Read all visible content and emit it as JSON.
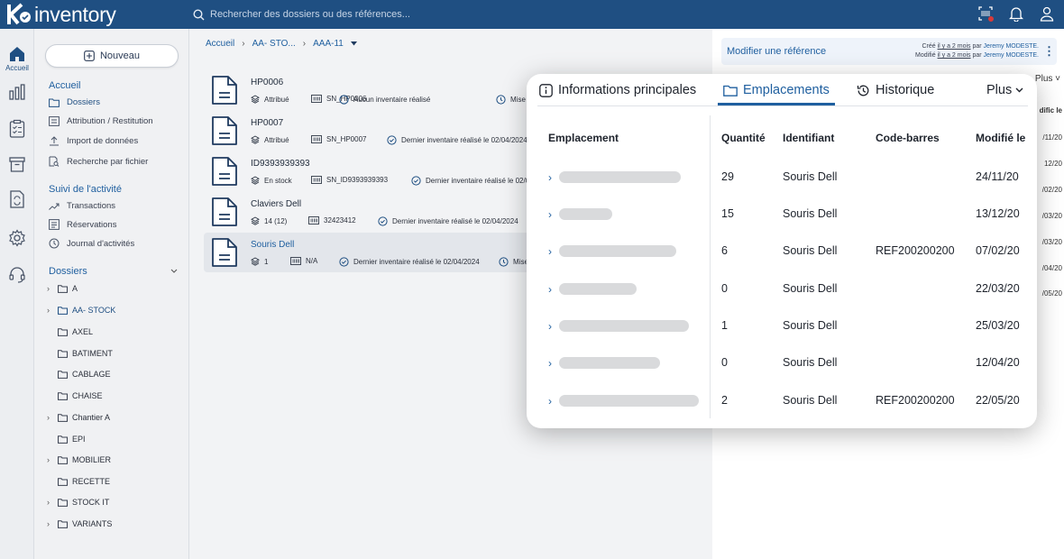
{
  "app": {
    "logo_text": "inventory"
  },
  "search": {
    "placeholder": "Rechercher des dossiers ou des références..."
  },
  "rail": {
    "home_label": "Accueil"
  },
  "sidebar": {
    "new_button": "Nouveau",
    "section_home": "Accueil",
    "home_items": [
      "Dossiers",
      "Attribution / Restitution",
      "Import de données",
      "Recherche par fichier"
    ],
    "section_activity": "Suivi de l'activité",
    "activity_items": [
      "Transactions",
      "Réservations",
      "Journal d'activités"
    ],
    "section_folders": "Dossiers",
    "folders": [
      {
        "name": "A",
        "expandable": true
      },
      {
        "name": "AA- STOCK",
        "expandable": true
      },
      {
        "name": "AXEL",
        "expandable": false
      },
      {
        "name": "BATIMENT",
        "expandable": false
      },
      {
        "name": "CABLAGE",
        "expandable": false
      },
      {
        "name": "CHAISE",
        "expandable": false
      },
      {
        "name": "Chantier A",
        "expandable": true
      },
      {
        "name": "EPI",
        "expandable": false
      },
      {
        "name": "MOBILIER",
        "expandable": true
      },
      {
        "name": "RECETTE",
        "expandable": false
      },
      {
        "name": "STOCK IT",
        "expandable": true
      },
      {
        "name": "VARIANTS",
        "expandable": true
      }
    ]
  },
  "breadcrumb": [
    "Accueil",
    "AA- STO...",
    "AAA-11"
  ],
  "items": [
    {
      "title": "HP0006",
      "status": "Attribué",
      "serial": "SN_HP0006",
      "inventory": "Aucun inventaire réalisé",
      "extra": "Mise"
    },
    {
      "title": "HP0007",
      "status": "Attribué",
      "serial": "SN_HP0007",
      "inventory": "Dernier inventaire réalisé le 02/04/2024",
      "extra": ""
    },
    {
      "title": "ID9393939393",
      "status": "En stock",
      "serial": "SN_ID9393939393",
      "inventory": "Dernier inventaire réalisé le 02/04",
      "extra": ""
    },
    {
      "title": "Claviers Dell",
      "status": "14 (12)",
      "serial": "32423412",
      "inventory": "Dernier inventaire réalisé le 02/04/2024",
      "extra": ""
    },
    {
      "title": "Souris Dell",
      "status": "1",
      "serial": "N/A",
      "inventory": "Dernier inventaire réalisé le 02/04/2024",
      "extra": "Mise"
    }
  ],
  "panel": {
    "title": "Modifier une référence",
    "created_prefix": "Créé ",
    "created_when": "il y a 2 mois",
    "created_by": " par ",
    "created_user": "Jeremy MODESTE.",
    "modified_prefix": "Modifié ",
    "modified_when": "il y a 2 mois",
    "modified_by": " par ",
    "modified_user": "Jeremy MODESTE.",
    "more": "Plus",
    "col_partial": "dific le",
    "dates_partial": [
      "/11/20",
      "12/20",
      "/02/20",
      "/03/20",
      "/03/20",
      "/04/20",
      "/05/20"
    ]
  },
  "modal": {
    "tabs": [
      "Informations principales",
      "Emplacements",
      "Historique"
    ],
    "more": "Plus",
    "columns": {
      "location": "Emplacement",
      "quantity": "Quantité",
      "identifier": "Identifiant",
      "barcode": "Code-barres",
      "modified": "Modifié le"
    },
    "rows": [
      {
        "quantity": "29",
        "identifier": "Souris Dell",
        "barcode": "",
        "modified": "24/11/20"
      },
      {
        "quantity": "15",
        "identifier": "Souris Dell",
        "barcode": "",
        "modified": "13/12/20"
      },
      {
        "quantity": "6",
        "identifier": "Souris Dell",
        "barcode": "REF200200200",
        "modified": "07/02/20"
      },
      {
        "quantity": "0",
        "identifier": "Souris Dell",
        "barcode": "",
        "modified": "22/03/20"
      },
      {
        "quantity": "1",
        "identifier": "Souris Dell",
        "barcode": "",
        "modified": "25/03/20"
      },
      {
        "quantity": "0",
        "identifier": "Souris Dell",
        "barcode": "",
        "modified": "12/04/20"
      },
      {
        "quantity": "2",
        "identifier": "Souris Dell",
        "barcode": "REF200200200",
        "modified": "22/05/20"
      }
    ]
  },
  "colors": {
    "topbar": "#1f4f82",
    "accent": "#1f5f9f"
  }
}
